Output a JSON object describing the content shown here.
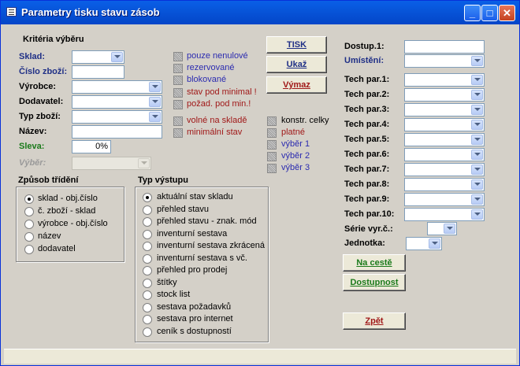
{
  "window": {
    "title": "Parametry tisku stavu zásob",
    "minimize": "_",
    "maximize": "□",
    "close": "✕"
  },
  "criteria": {
    "heading": "Kritéria výběru",
    "sklad": "Sklad:",
    "cislo_zbozi": "Číslo zboží:",
    "vyrobce": "Výrobce:",
    "dodavatel": "Dodavatel:",
    "typ_zbozi": "Typ zboží:",
    "nazev": "Název:",
    "sleva": "Sleva:",
    "sleva_value": "0%",
    "vyber": "Výběr:"
  },
  "checks_a": [
    {
      "label": "pouze nenulové",
      "color": "blue"
    },
    {
      "label": "rezervované",
      "color": "blue"
    },
    {
      "label": "blokované",
      "color": "blue"
    },
    {
      "label": "stav pod minimal !",
      "color": "red"
    },
    {
      "label": "požad. pod min.!",
      "color": "red"
    },
    {
      "label": "volné na skladě",
      "color": "red"
    },
    {
      "label": "minimální stav",
      "color": "red"
    }
  ],
  "checks_b": [
    {
      "label": "konstr. celky",
      "color": "black"
    },
    {
      "label": "platné",
      "color": "red"
    },
    {
      "label": "výběr 1",
      "color": "blue"
    },
    {
      "label": "výběr 2",
      "color": "blue"
    },
    {
      "label": "výběr 3",
      "color": "blue"
    }
  ],
  "buttons": {
    "tisk": "TISK",
    "ukaz": "Ukaž",
    "vymaz": "Výmaz",
    "na_ceste": "Na cestě",
    "dostupnost": "Dostupnost",
    "zpet": "Zpět"
  },
  "sort": {
    "heading": "Způsob třídění",
    "options": [
      "sklad - obj.číslo",
      "č. zboží - sklad",
      "výrobce - obj.číslo",
      "název",
      "dodavatel"
    ],
    "selected": 0
  },
  "output": {
    "heading": "Typ výstupu",
    "options": [
      "aktuální stav skladu",
      "přehled stavu",
      "přehled stavu - znak. mód",
      "inventurní sestava",
      "inventurní sestava zkrácená",
      "inventurní sestava s vč.",
      "přehled pro prodej",
      "štítky",
      "stock list",
      "sestava požadavků",
      "sestava pro internet",
      "ceník s dostupností"
    ],
    "selected": 0
  },
  "right": {
    "dostup": "Dostup.1:",
    "umisteni": "Umístění:",
    "tech": [
      "Tech par.1:",
      "Tech par.2:",
      "Tech par.3:",
      "Tech par.4:",
      "Tech par.5:",
      "Tech par.6:",
      "Tech par.7:",
      "Tech par.8:",
      "Tech par.9:",
      "Tech par.10:"
    ],
    "serie": "Série vyr.č.:",
    "jednotka": "Jednotka:"
  }
}
